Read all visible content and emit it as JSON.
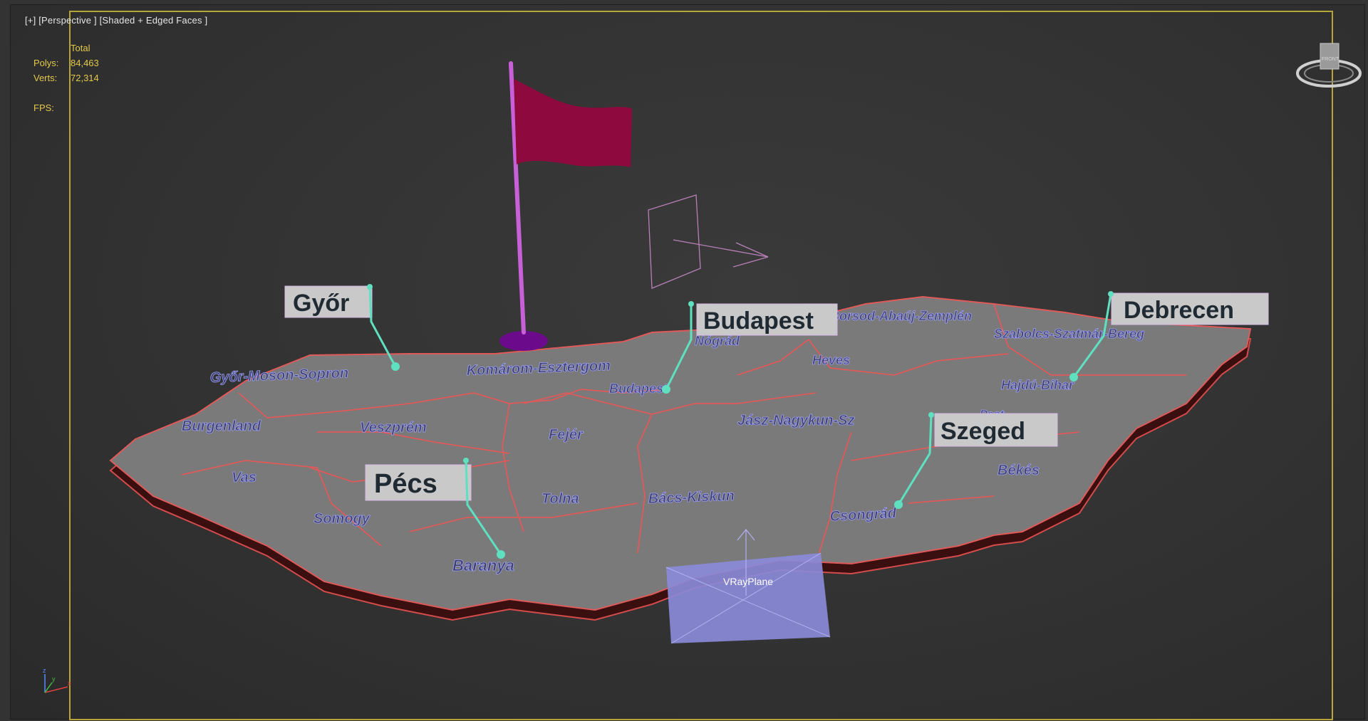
{
  "viewport": {
    "menu_plus": "[+]",
    "view_name": "[Perspective ]",
    "shading_mode": "[Shaded + Edged Faces ]"
  },
  "stats": {
    "header": "Total",
    "polys_label": "Polys:",
    "polys_value": "84,463",
    "verts_label": "Verts:",
    "verts_value": "72,314",
    "fps_label": "FPS:",
    "fps_value": ""
  },
  "city_labels": {
    "gyor": "Győr",
    "budapest": "Budapest",
    "debrecen": "Debrecen",
    "szeged": "Szeged",
    "pecs": "Pécs"
  },
  "regions": {
    "gyor_moson_sopron": "Győr-Moson-Sopron",
    "komarom": "Komárom-Esztergom",
    "nograd": "Nógrád",
    "borsod": "Borsod-Abaúj-Zemplén",
    "szabolcs": "Szabolcs-Szatmár-Bereg",
    "heves": "Heves",
    "budapest": "Budapest",
    "hajdu_bihar": "Hajdú-Bihar",
    "burgenland": "Burgenland",
    "veszprem": "Veszprém",
    "fejer": "Fejér",
    "jasz": "Jász-Nagykun-Sz",
    "pest": "Pest",
    "vas": "Vas",
    "tolna": "Tolna",
    "bacs_kiskun": "Bács-Kiskun",
    "bekes": "Békés",
    "somogy": "Somogy",
    "csongrad": "Csongrád",
    "baranya": "Baranya"
  },
  "objects": {
    "vray_plane": "VRayPlane"
  },
  "viewcube": {
    "face_label": "FRONT"
  },
  "gizmo": {
    "z": "z",
    "y": "y",
    "x": "x"
  },
  "colors": {
    "safe_frame": "#b9a43a",
    "stats_text": "#e4c84a",
    "map_surface": "#7a7a7a",
    "map_edge": "#e05a5a",
    "flag": "#8e0a3e",
    "flag_pole": "#c860d8",
    "flag_base": "#6c0a8c",
    "label_leader": "#5fe0c0",
    "vray_plane": "#8a8ad8"
  },
  "icons": {
    "viewcube": "viewcube-icon",
    "axis": "axis-tripod-icon"
  }
}
